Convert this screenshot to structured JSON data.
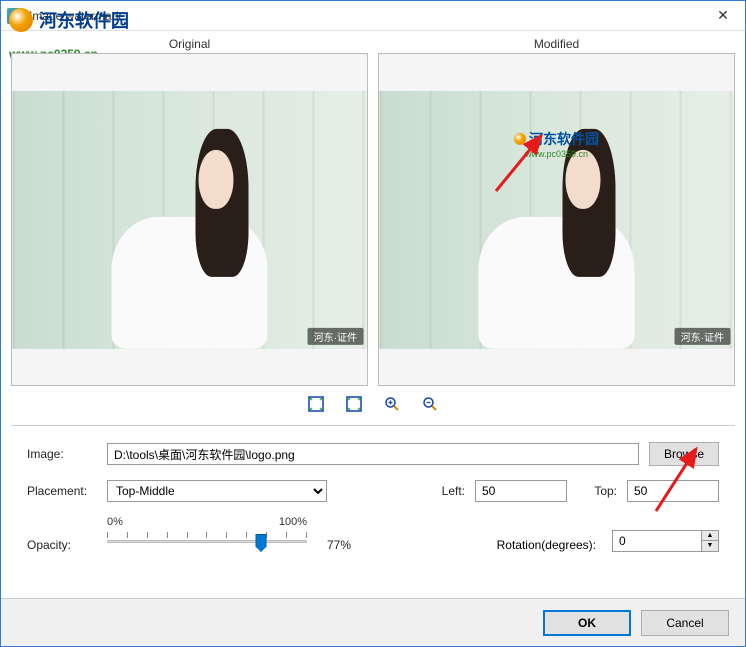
{
  "window": {
    "title": "Image watermark"
  },
  "watermark_overlay": {
    "cn": "河东软件园",
    "url": "www.pc0359.cn"
  },
  "preview": {
    "original_label": "Original",
    "modified_label": "Modified",
    "corner_tag": "河东·证件"
  },
  "toolbar": {
    "fit_icon": "fit-window-icon",
    "actual_icon": "actual-size-icon",
    "zoom_in_icon": "zoom-in-icon",
    "zoom_out_icon": "zoom-out-icon"
  },
  "form": {
    "image_label": "Image:",
    "image_path": "D:\\tools\\桌面\\河东软件园\\logo.png",
    "browse_label": "Browse",
    "placement_label": "Placement:",
    "placement_value": "Top-Middle",
    "left_label": "Left:",
    "left_value": "50",
    "top_label": "Top:",
    "top_value": "50",
    "opacity_label": "Opacity:",
    "opacity_min": "0%",
    "opacity_max": "100%",
    "opacity_value": "77%",
    "rotation_label": "Rotation(degrees):",
    "rotation_value": "0"
  },
  "buttons": {
    "ok": "OK",
    "cancel": "Cancel"
  }
}
